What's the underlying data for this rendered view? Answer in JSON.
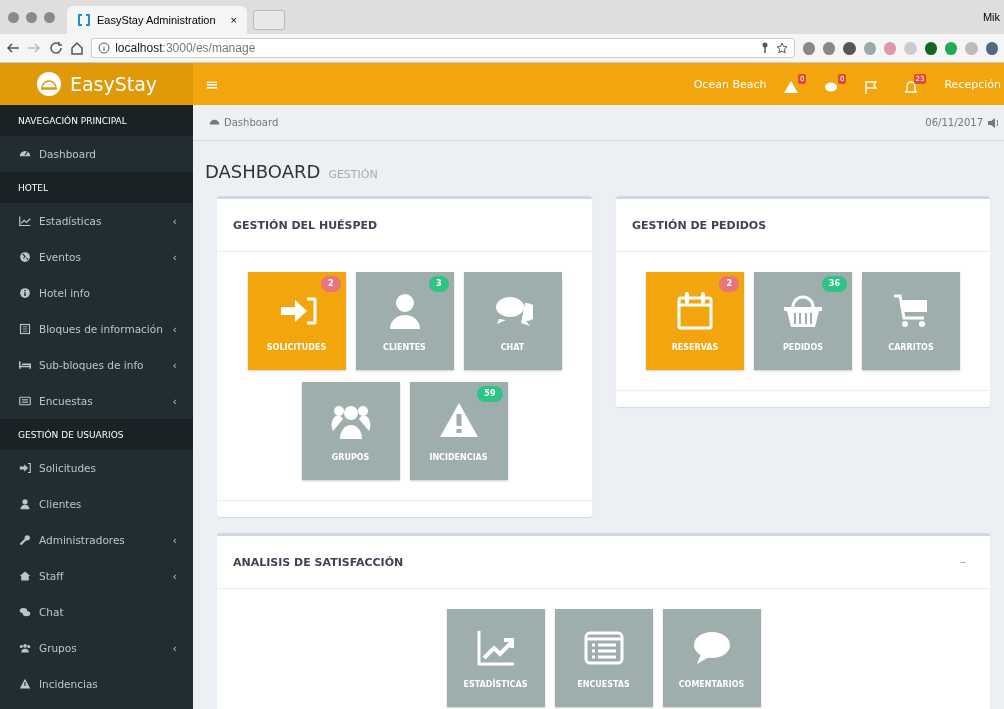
{
  "browser": {
    "tab_title": "EasyStay Administration",
    "tab_close": "×",
    "url_host": "localhost",
    "url_path": ":3000/es/manage",
    "profile": "Mik"
  },
  "header": {
    "logo": "EasyStay",
    "menu": "≡",
    "hotel": "Ocean Beach",
    "alerts": [
      {
        "kind": "warning",
        "badge": "0"
      },
      {
        "kind": "chat",
        "badge": "0"
      },
      {
        "kind": "flag"
      },
      {
        "kind": "bell",
        "badge": "23"
      }
    ],
    "user": "Recepción"
  },
  "sidebar": [
    {
      "kind": "header",
      "label": "NAVEGACIÓN PRINCIPAL"
    },
    {
      "kind": "item",
      "label": "Dashboard"
    },
    {
      "kind": "header",
      "label": "HOTEL"
    },
    {
      "kind": "item",
      "label": "Estadísticas",
      "chevron": "‹"
    },
    {
      "kind": "item",
      "label": "Eventos",
      "chevron": "‹"
    },
    {
      "kind": "item",
      "label": "Hotel info"
    },
    {
      "kind": "item",
      "label": "Bloques de información",
      "chevron": "‹"
    },
    {
      "kind": "item",
      "label": "Sub-bloques de info",
      "chevron": "‹"
    },
    {
      "kind": "item",
      "label": "Encuestas",
      "chevron": "‹"
    },
    {
      "kind": "header",
      "label": "GESTIÓN DE USUARIOS"
    },
    {
      "kind": "item",
      "label": "Solicitudes"
    },
    {
      "kind": "item",
      "label": "Clientes"
    },
    {
      "kind": "item",
      "label": "Administradores",
      "chevron": "‹"
    },
    {
      "kind": "item",
      "label": "Staff",
      "chevron": "‹"
    },
    {
      "kind": "item",
      "label": "Chat"
    },
    {
      "kind": "item",
      "label": "Grupos",
      "chevron": "‹"
    },
    {
      "kind": "item",
      "label": "Incidencias"
    }
  ],
  "breadcrumb": "Dashboard",
  "date": "06/11/2017",
  "page_title": "DASHBOARD",
  "page_subtitle": "GESTIÓN",
  "cards": [
    {
      "title": "GESTIÓN DEL HUÉSPED",
      "tiles": [
        {
          "label": "SOLICITUDES",
          "color": "#f2a50c",
          "badge": {
            "text": "2",
            "color": "#e8747c"
          }
        },
        {
          "label": "CLIENTES",
          "color": "#9daeac",
          "badge": {
            "text": "3",
            "color": "#2ec486"
          }
        },
        {
          "label": "CHAT",
          "color": "#9daeac"
        },
        {
          "label": "GRUPOS",
          "color": "#9daeac"
        },
        {
          "label": "INCIDENCIAS",
          "color": "#9daeac",
          "badge": {
            "text": "59",
            "color": "#2ec486"
          }
        }
      ]
    },
    {
      "title": "GESTIÓN DE PEDIDOS",
      "tiles": [
        {
          "label": "RESERVAS",
          "color": "#f2a50c",
          "badge": {
            "text": "2",
            "color": "#e8747c"
          }
        },
        {
          "label": "PEDIDOS",
          "color": "#9daeac",
          "badge": {
            "text": "36",
            "color": "#2ec486"
          }
        },
        {
          "label": "CARRITOS",
          "color": "#9daeac"
        }
      ]
    },
    {
      "title": "ANALISIS DE SATISFACCIÓN",
      "collapse": "–",
      "tiles": [
        {
          "label": "ESTADÍSTICAS",
          "color": "#9daeac"
        },
        {
          "label": "ENCUESTAS",
          "color": "#9daeac"
        },
        {
          "label": "COMENTARIOS",
          "color": "#9daeac"
        }
      ]
    }
  ]
}
